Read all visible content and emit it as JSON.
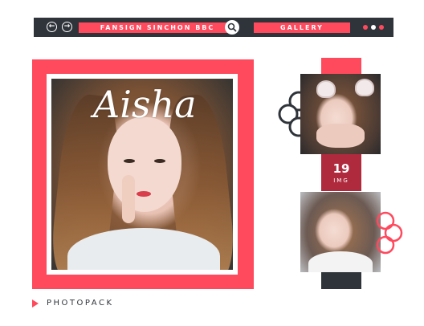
{
  "toolbar": {
    "back_icon": "arrow-left-circle-icon",
    "forward_icon": "arrow-right-circle-icon",
    "search_tab_label": "FANSIGN SINCHON BBC",
    "search_icon": "search-icon",
    "gallery_tab_label": "GALLERY",
    "dots": [
      {
        "icon": "dot-icon",
        "color": "#ff4a5e"
      },
      {
        "icon": "dot-icon",
        "color": "#ffffff"
      },
      {
        "icon": "dot-icon",
        "color": "#ff4a5e"
      }
    ]
  },
  "main_photo": {
    "signature": "Aisha"
  },
  "footer": {
    "icon": "play-triangle-icon",
    "label": "PHOTOPACK"
  },
  "gallery": {
    "count": "19",
    "count_label": "IMG",
    "decorations": [
      "flower-outline-icon",
      "flower-outline-icon"
    ]
  },
  "colors": {
    "accent": "#ff4a5e",
    "dark": "#2f343a",
    "count_bg": "#b02a3e",
    "white": "#ffffff"
  }
}
